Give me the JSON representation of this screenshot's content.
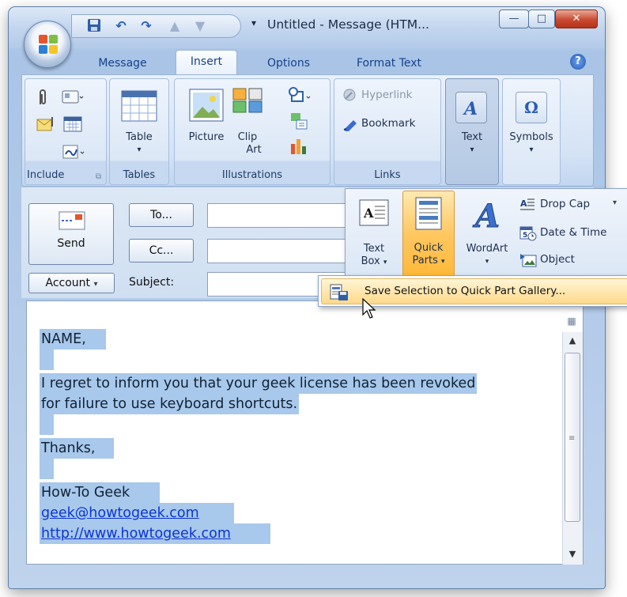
{
  "window": {
    "title": "Untitled - Message (HTM...",
    "controls": {
      "minimize": "—",
      "maximize": "□",
      "close": "✕"
    }
  },
  "tabs": [
    "Message",
    "Insert",
    "Options",
    "Format Text"
  ],
  "active_tab": "Insert",
  "ribbon": {
    "groups": {
      "include": "Include",
      "tables": "Tables",
      "illustrations": "Illustrations",
      "links": "Links"
    },
    "table_label": "Table",
    "picture_label": "Picture",
    "clipart_label_1": "Clip",
    "clipart_label_2": "Art",
    "hyperlink_label": "Hyperlink",
    "bookmark_label": "Bookmark",
    "text_label": "Text",
    "symbols_label": "Symbols",
    "dropdown_arrow": "▾"
  },
  "text_dropdown": {
    "textbox_1": "Text",
    "textbox_2": "Box",
    "quickparts_1": "Quick",
    "quickparts_2": "Parts",
    "wordart": "WordArt",
    "dropcap": "Drop Cap",
    "datetime": "Date & Time",
    "object": "Object",
    "arrow": "▾"
  },
  "quickparts_menu": {
    "item": "Save Selection to Quick Part Gallery..."
  },
  "form": {
    "send": "Send",
    "to": "To...",
    "cc": "Cc...",
    "account": "Account",
    "account_arrow": "▾",
    "subject": "Subject:",
    "to_value": "",
    "cc_value": "",
    "subject_value": ""
  },
  "message": {
    "line1": "NAME,",
    "line2": "I regret to inform you that your geek license has been revoked",
    "line3": "for failure to use keyboard shortcuts.",
    "line4": "Thanks,",
    "line5": "How-To Geek",
    "email": "geek@howtogeek.com",
    "url": "http://www.howtogeek.com"
  },
  "colors": {
    "accent": "#15428b",
    "selection": "#a8c8ec",
    "highlight": "#ffc760",
    "link": "#0b36d1"
  }
}
